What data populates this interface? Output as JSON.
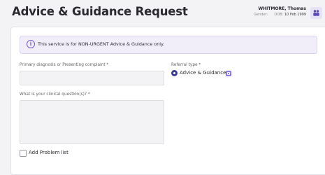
{
  "header": {
    "title": "Advice & Guidance Request",
    "patient": {
      "name": "WHITMORE, Thomas",
      "gender_label": "Gender:",
      "gender_value": "",
      "dob_label": "DOB:",
      "dob_value": "10 Feb 1999"
    },
    "avatar_icon": "people-icon"
  },
  "notice": {
    "icon": "info-icon",
    "text": "This service is for NON-URGENT Advice & Guidance only."
  },
  "form": {
    "diagnosis": {
      "label": "Primary diagnosis or Presenting complaint *",
      "value": ""
    },
    "referral_type": {
      "label": "Referral type *",
      "selected": "Advice & Guidance",
      "badge_icon": "info-badge-icon"
    },
    "clinical_question": {
      "label": "What is your clinical question(s)? *",
      "value": ""
    },
    "problem_list": {
      "label": "Add Problem list",
      "checked": false
    }
  },
  "colors": {
    "accent": "#3e3f93",
    "badge": "#8f7be0",
    "notice_bg": "#f1eef9"
  }
}
